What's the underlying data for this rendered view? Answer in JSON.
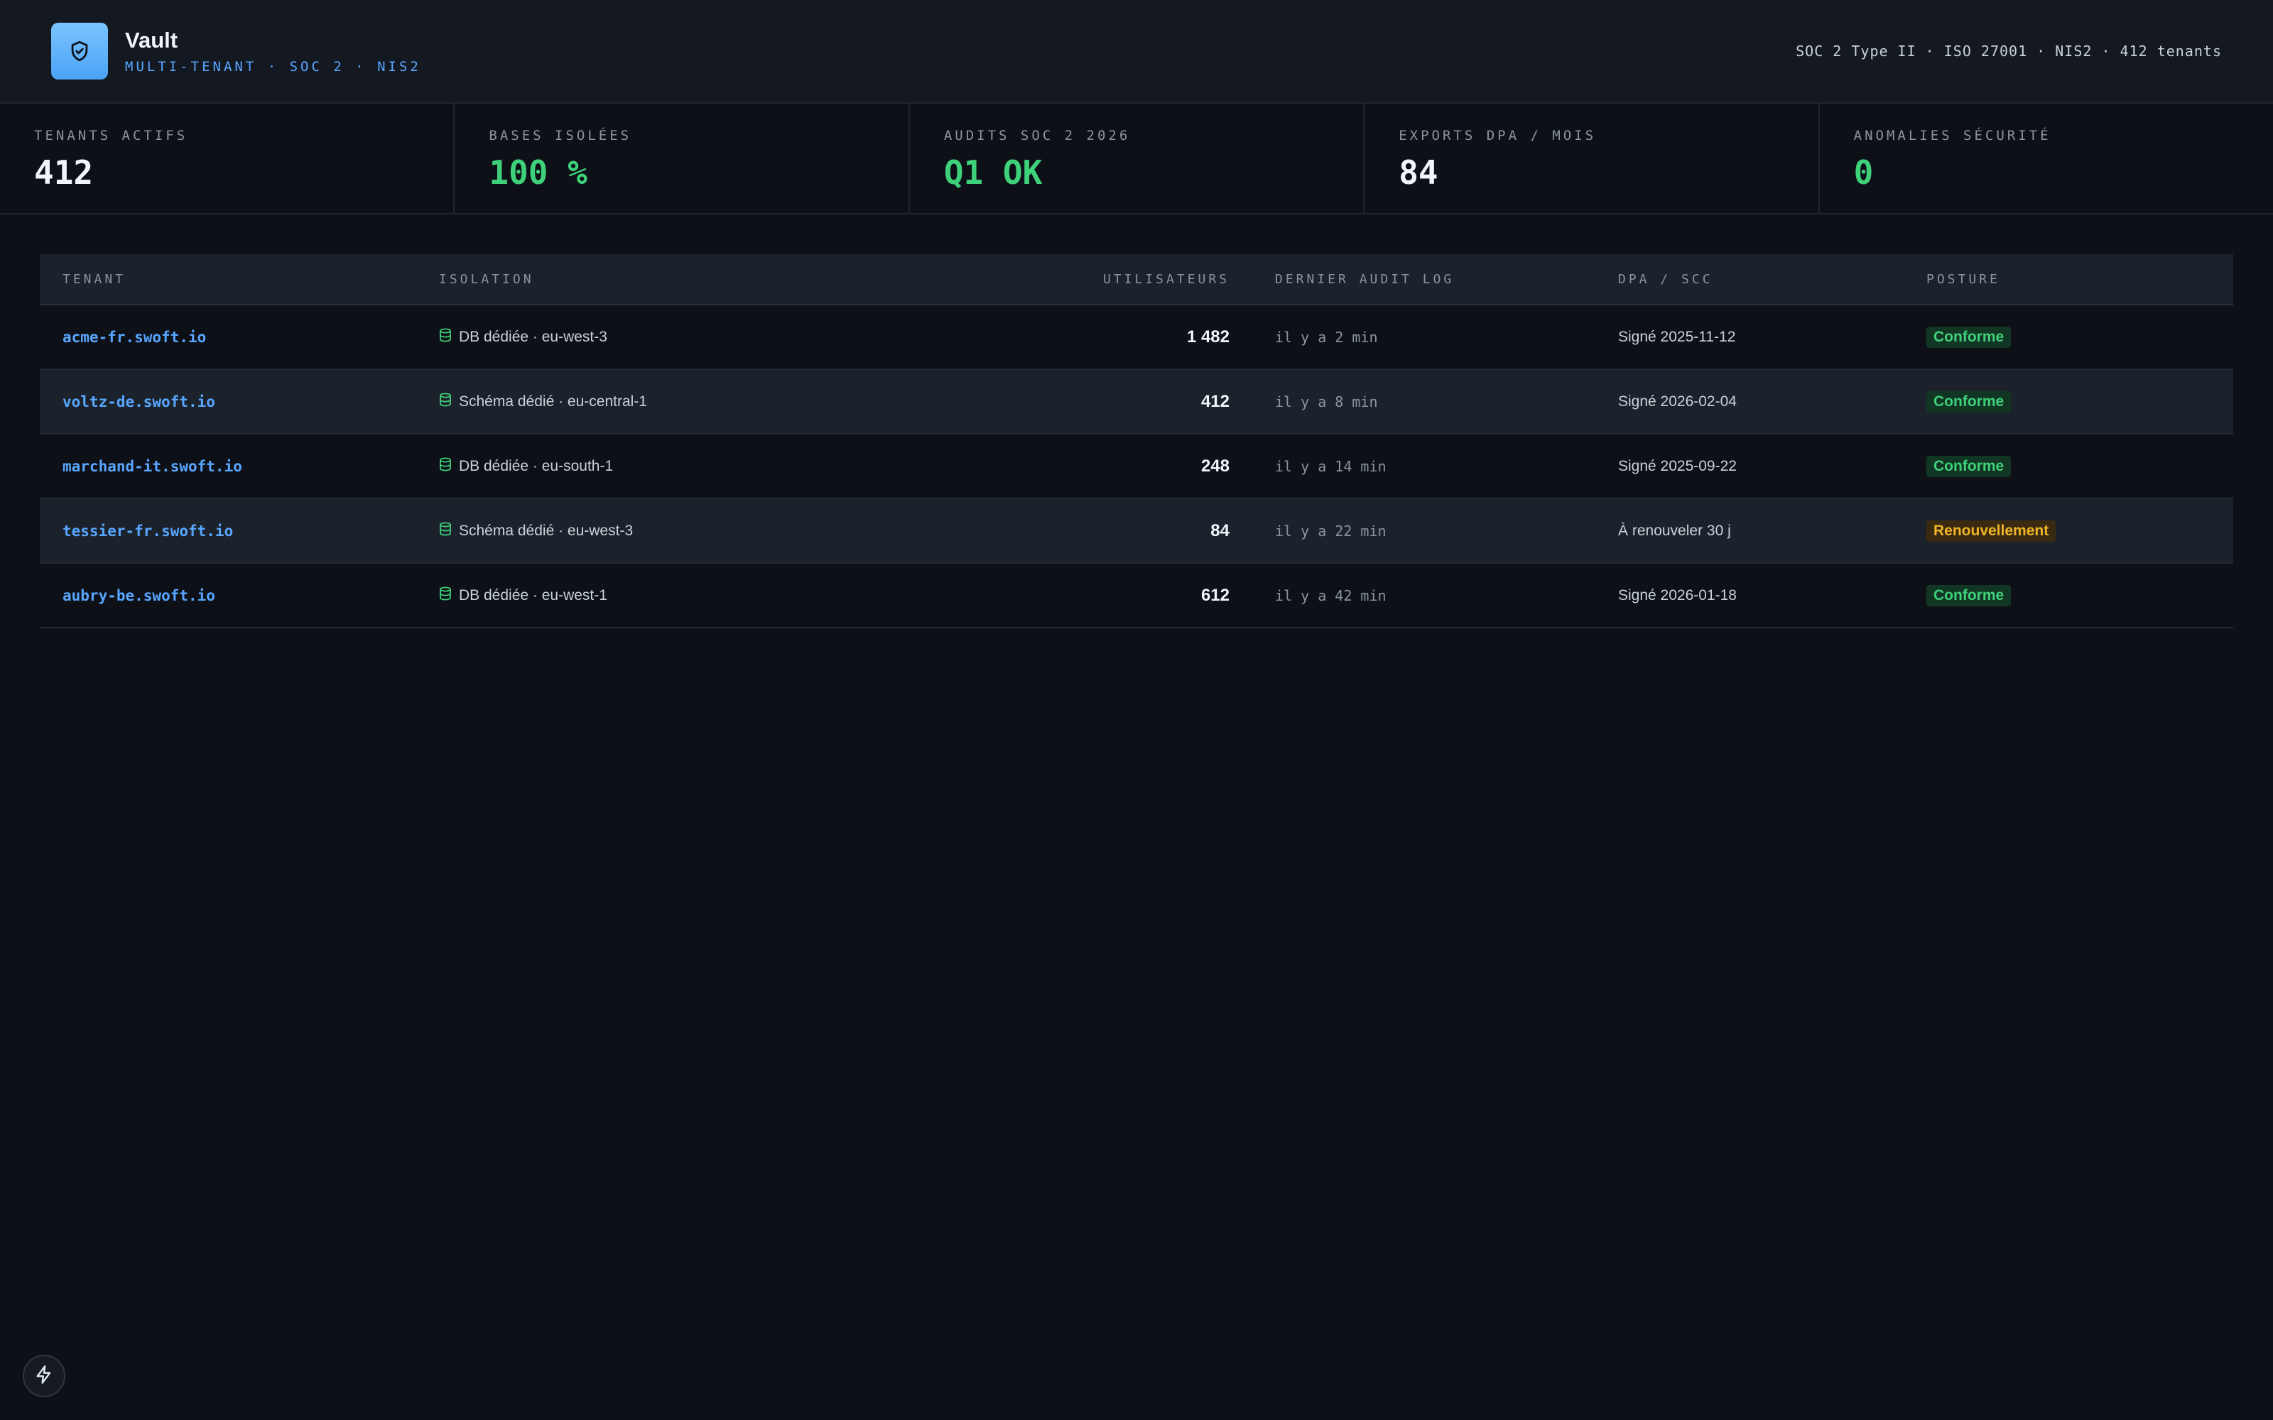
{
  "header": {
    "title": "Vault",
    "subtitle": "MULTI-TENANT · SOC 2 · NIS2",
    "compliance": "SOC 2 Type II · ISO 27001 · NIS2 · 412 tenants",
    "logo_icon": "shield-check-icon"
  },
  "stats": [
    {
      "label": "TENANTS ACTIFS",
      "value": "412",
      "color": "#f0f6fc"
    },
    {
      "label": "BASES ISOLÉES",
      "value": "100 %",
      "color": "#3fd07a"
    },
    {
      "label": "AUDITS SOC 2 2026",
      "value": "Q1 OK",
      "color": "#3fd07a"
    },
    {
      "label": "EXPORTS DPA / MOIS",
      "value": "84",
      "color": "#f0f6fc"
    },
    {
      "label": "ANOMALIES SÉCURITÉ",
      "value": "0",
      "color": "#3fd07a"
    }
  ],
  "table": {
    "columns": [
      "TENANT",
      "ISOLATION",
      "UTILISATEURS",
      "DERNIER AUDIT LOG",
      "DPA / SCC",
      "POSTURE"
    ],
    "rows": [
      {
        "tenant": "acme-fr.swoft.io",
        "isolation": "DB dédiée · eu-west-3",
        "users": "1 482",
        "audit": "il y a 2 min",
        "dpa": "Signé 2025-11-12",
        "posture": "Conforme",
        "status": "ok"
      },
      {
        "tenant": "voltz-de.swoft.io",
        "isolation": "Schéma dédié · eu-central-1",
        "users": "412",
        "audit": "il y a 8 min",
        "dpa": "Signé 2026-02-04",
        "posture": "Conforme",
        "status": "ok"
      },
      {
        "tenant": "marchand-it.swoft.io",
        "isolation": "DB dédiée · eu-south-1",
        "users": "248",
        "audit": "il y a 14 min",
        "dpa": "Signé 2025-09-22",
        "posture": "Conforme",
        "status": "ok"
      },
      {
        "tenant": "tessier-fr.swoft.io",
        "isolation": "Schéma dédié · eu-west-3",
        "users": "84",
        "audit": "il y a 22 min",
        "dpa": "À renouveler 30 j",
        "posture": "Renouvellement",
        "status": "warn"
      },
      {
        "tenant": "aubry-be.swoft.io",
        "isolation": "DB dédiée · eu-west-1",
        "users": "612",
        "audit": "il y a 42 min",
        "dpa": "Signé 2026-01-18",
        "posture": "Conforme",
        "status": "ok"
      }
    ]
  },
  "colors": {
    "accent": "#58a6ff",
    "success": "#3fd07a",
    "warning": "#f0b429",
    "background": "#0d1117"
  },
  "fab_icon": "lightning-icon"
}
